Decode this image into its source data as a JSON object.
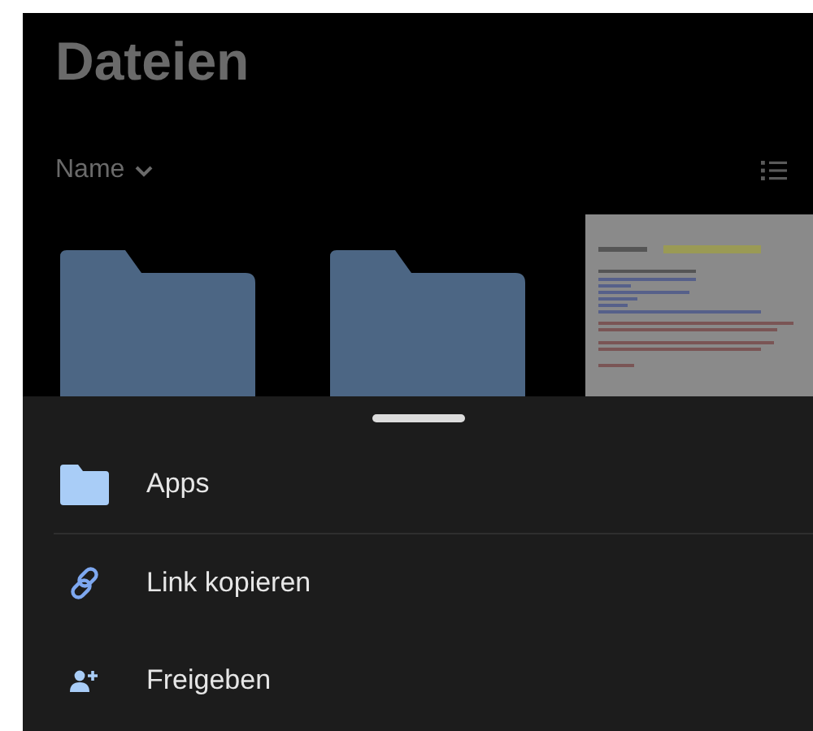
{
  "title": "Dateien",
  "sort": {
    "label": "Name"
  },
  "files": [
    {
      "kind": "folder"
    },
    {
      "kind": "folder"
    },
    {
      "kind": "document"
    }
  ],
  "sheet": {
    "sections": [
      [
        {
          "label": "Apps",
          "kind": "folder"
        }
      ],
      [
        {
          "label": "Link kopieren",
          "kind": "link"
        },
        {
          "label": "Freigeben",
          "kind": "share"
        }
      ]
    ]
  }
}
